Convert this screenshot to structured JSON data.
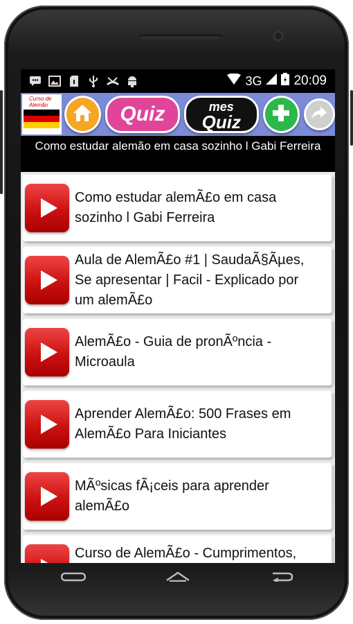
{
  "status_bar": {
    "network": "3G",
    "time": "20:09",
    "left_icons": [
      "message-icon",
      "image-icon",
      "sd-card-icon",
      "usb-icon",
      "missed-call-icon",
      "android-debug-icon"
    ],
    "right_icons": [
      "wifi-icon",
      "signal-icon",
      "battery-icon"
    ]
  },
  "toolbar": {
    "logo_text": "Curso de Alemão",
    "quiz_label": "Quiz",
    "mes_label": "mes",
    "mes_quiz_label": "Quiz",
    "colors": {
      "bar": "#7b8bd8",
      "home": "#f5a623",
      "quiz": "#e0459a",
      "mesquiz": "#111111",
      "add": "#2db84b",
      "share": "#cfcfcf"
    }
  },
  "title": "Como estudar alemão em casa sozinho l Gabi Ferreira",
  "videos": [
    {
      "title": "Como estudar alemÃ£o em casa sozinho l Gabi Ferreira"
    },
    {
      "title": "Aula de AlemÃ£o #1 | SaudaÃ§Ãµes, Se apresentar | Facil - Explicado por um alemÃ£o"
    },
    {
      "title": "AlemÃ£o - Guia de pronÃºncia - Microaula"
    },
    {
      "title": "Aprender AlemÃ£o: 500 Frases em AlemÃ£o Para Iniciantes"
    },
    {
      "title": "MÃºsicas fÃ¡ceis para aprender alemÃ£o"
    },
    {
      "title": "Curso de AlemÃ£o - Cumprimentos,"
    }
  ],
  "nav_bar": {
    "icons": [
      "back-icon",
      "home-icon",
      "recent-apps-icon"
    ]
  }
}
